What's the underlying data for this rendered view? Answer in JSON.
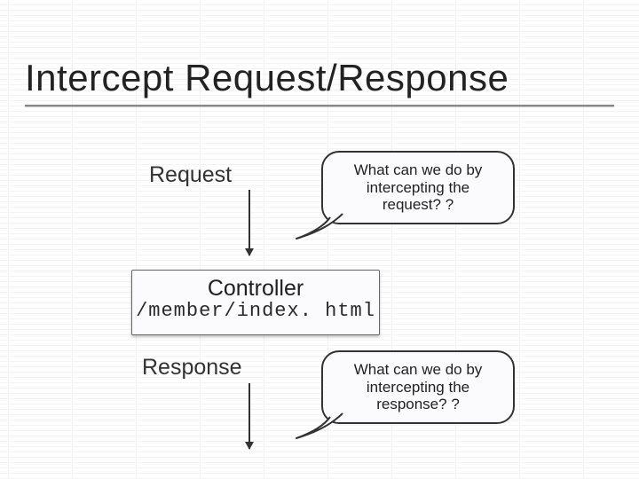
{
  "title": "Intercept Request/Response",
  "labels": {
    "request": "Request",
    "response": "Response"
  },
  "controller": {
    "title": "Controller",
    "path": "/member/index. html"
  },
  "callouts": {
    "request": "What can we do by intercepting the request? ?",
    "response": "What can we do by intercepting the response? ?"
  }
}
